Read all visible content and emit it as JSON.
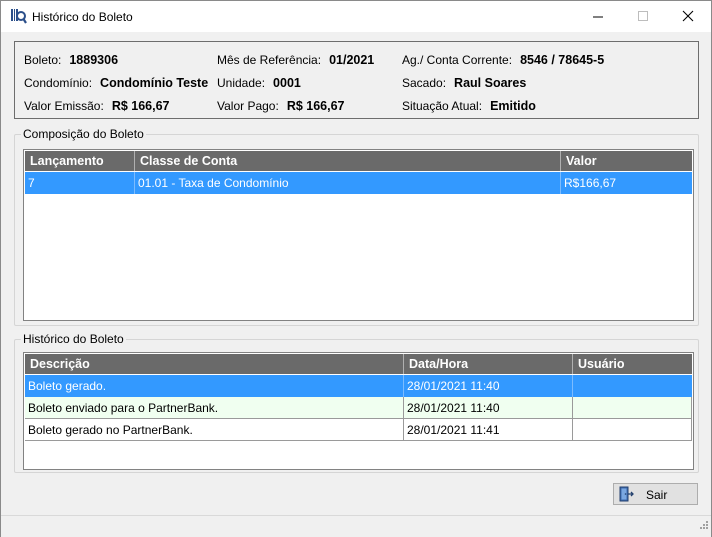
{
  "window": {
    "title": "Histórico do Boleto"
  },
  "info": {
    "boleto_label": "Boleto:",
    "boleto_value": "1889306",
    "mes_label": "Mês de Referência:",
    "mes_value": "01/2021",
    "agconta_label": "Ag./ Conta Corrente:",
    "agconta_value": "8546 / 78645-5",
    "condominio_label": "Condomínio:",
    "condominio_value": "Condomínio Teste",
    "unidade_label": "Unidade:",
    "unidade_value": "0001",
    "sacado_label": "Sacado:",
    "sacado_value": "Raul Soares",
    "valor_emissao_label": "Valor Emissão:",
    "valor_emissao_value": "R$ 166,67",
    "valor_pago_label": "Valor Pago:",
    "valor_pago_value": "R$ 166,67",
    "situacao_label": "Situação Atual:",
    "situacao_value": "Emitido"
  },
  "composicao": {
    "title": "Composição do Boleto",
    "columns": [
      "Lançamento",
      "Classe de Conta",
      "Valor"
    ],
    "rows": [
      [
        "7",
        "01.01 - Taxa de Condomínio",
        "R$166,67"
      ]
    ]
  },
  "historico": {
    "title": "Histórico do Boleto",
    "columns": [
      "Descrição",
      "Data/Hora",
      "Usuário"
    ],
    "rows": [
      [
        "Boleto gerado.",
        "28/01/2021 11:40",
        ""
      ],
      [
        "Boleto enviado para o PartnerBank.",
        "28/01/2021 11:40",
        ""
      ],
      [
        "Boleto gerado no PartnerBank.",
        "28/01/2021 11:41",
        ""
      ]
    ]
  },
  "footer": {
    "sair_label": "Sair"
  },
  "colors": {
    "selection": "#3399ff",
    "grid_header": "#6a6a6a",
    "alt_row": "#f0fff0"
  },
  "icons": {
    "app": "boleto-search-icon",
    "minimize": "minimize-icon",
    "maximize": "maximize-icon",
    "close": "close-icon",
    "sair": "exit-door-icon",
    "grip": "resize-grip-icon"
  }
}
